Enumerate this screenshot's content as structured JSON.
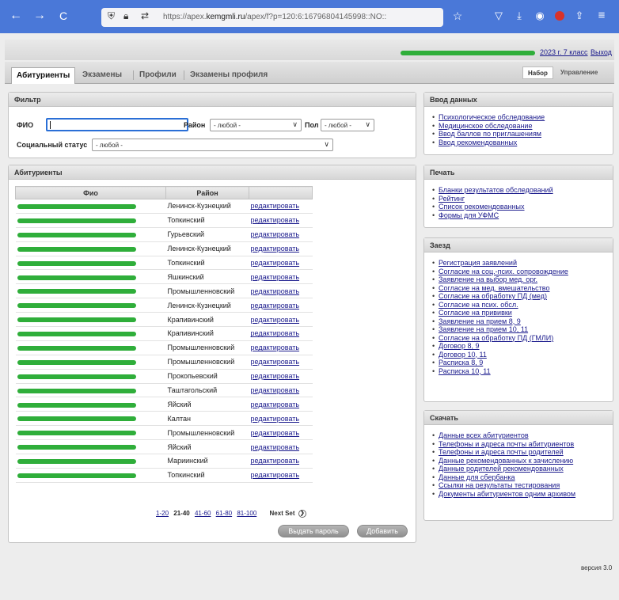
{
  "browser": {
    "back_glyph": "←",
    "forward_glyph": "→",
    "reload_glyph": "C",
    "url_prefix": "https://apex.",
    "url_domain": "kemgmli.ru",
    "url_rest": "/apex/f?p=120:6:16796804145998::NO::"
  },
  "header": {
    "year_link": "2023 г. 7 класс",
    "logout_link": "Выход"
  },
  "tabs": [
    "Абитуриенты",
    "Экзамены",
    "Профили",
    "Экзамены профиля"
  ],
  "mode_tabs": [
    "Набор",
    "Управление"
  ],
  "filter": {
    "title": "Фильтр",
    "fio_label": "ФИО",
    "fio_value": "",
    "district_label": "Район",
    "district_value": "- любой -",
    "gender_label": "Пол",
    "gender_value": "- любой -",
    "social_label": "Социальный статус",
    "social_value": "- любой -"
  },
  "applicants": {
    "title": "Абитуриенты",
    "columns": [
      "Фио",
      "Район"
    ],
    "rows": [
      {
        "district": "Ленинск-Кузнецкий",
        "action": "редактировать"
      },
      {
        "district": "Топкинский",
        "action": "редактировать"
      },
      {
        "district": "Гурьевский",
        "action": "редактировать"
      },
      {
        "district": "Ленинск-Кузнецкий",
        "action": "редактировать"
      },
      {
        "district": "Топкинский",
        "action": "редактировать"
      },
      {
        "district": "Яшкинский",
        "action": "редактировать"
      },
      {
        "district": "Промышленновский",
        "action": "редактировать"
      },
      {
        "district": "Ленинск-Кузнецкий",
        "action": "редактировать"
      },
      {
        "district": "Крапивинский",
        "action": "редактировать"
      },
      {
        "district": "Крапивинский",
        "action": "редактировать"
      },
      {
        "district": "Промышленновский",
        "action": "редактировать"
      },
      {
        "district": "Промышленновский",
        "action": "редактировать"
      },
      {
        "district": "Прокопьевский",
        "action": "редактировать"
      },
      {
        "district": "Таштагольский",
        "action": "редактировать"
      },
      {
        "district": "Яйский",
        "action": "редактировать"
      },
      {
        "district": "Калтан",
        "action": "редактировать"
      },
      {
        "district": "Промышленновский",
        "action": "редактировать"
      },
      {
        "district": "Яйский",
        "action": "редактировать"
      },
      {
        "district": "Мариинский",
        "action": "редактировать"
      },
      {
        "district": "Топкинский",
        "action": "редактировать"
      }
    ],
    "pager": {
      "pages": [
        "1-20",
        "21-40",
        "41-60",
        "61-80",
        "81-100"
      ],
      "current": "21-40",
      "next_label": "Next Set"
    },
    "reset_password_button": "Выдать пароль",
    "add_button": "Добавить"
  },
  "data_entry": {
    "title": "Ввод данных",
    "links": [
      "Психологическое обследование",
      "Медицинское обследование",
      "Ввод баллов по приглашениям",
      "Ввод рекомендованных"
    ]
  },
  "print": {
    "title": "Печать",
    "links": [
      "Бланки результатов обследований",
      "Рейтинг",
      "Список рекомендованных",
      "Формы для УФМС"
    ]
  },
  "check_in": {
    "title": "Заезд",
    "links": [
      "Регистрация заявлений",
      "Согласие на соц.-псих. сопровождение",
      "Заявление на выбор мед. орг.",
      "Согласие на мед. вмешательство",
      "Согласие на обработку ПД (мед)",
      "Согласие на псих. обсл.",
      "Согласие на прививки",
      "Заявление на прием 8, 9",
      "Заявление на прием 10, 11",
      "Согласие на обработку ПД (ГМЛИ)",
      "Договор 8, 9",
      "Договор 10, 11",
      "Расписка 8, 9",
      "Расписка 10, 11"
    ]
  },
  "download": {
    "title": "Скачать",
    "links": [
      "Данные всех абитуриентов",
      "Телефоны и адреса почты абитуриентов",
      "Телефоны и адреса почты родителей",
      "Данные рекомендованных к зачислению",
      "Данные родителей рекомендованных",
      "Данные для сбербанка",
      "Ссылки на результаты тестирования",
      "Документы абитуриентов одним архивом"
    ]
  },
  "version": "версия 3.0"
}
